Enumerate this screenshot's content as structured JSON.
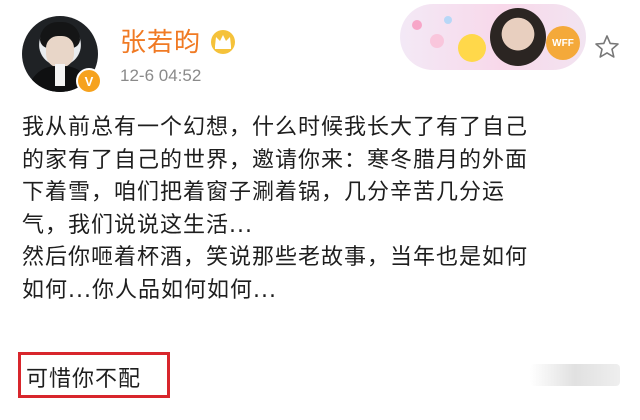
{
  "post": {
    "username": "张若昀",
    "timestamp": "12-6 04:52",
    "verified_badge": "V",
    "icons": {
      "crown": "crown-icon",
      "star": "star-icon",
      "verified": "verified-badge-icon"
    },
    "colors": {
      "username": "#f07a24",
      "timestamp": "#8a8a8a",
      "text": "#1e1e1e",
      "highlight_border": "#d8262c",
      "verified_badge": "#f6a21e"
    },
    "card_skin": {
      "badge_text": "WFF"
    },
    "body_lines": [
      "我从前总有一个幻想，什么时候我长大了有了自己",
      "的家有了自己的世界，邀请你来：寒冬腊月的外面",
      "下着雪，咱们把着窗子涮着锅，几分辛苦几分运",
      "气，我们说说这生活...",
      "然后你咂着杯酒，笑说那些老故事，当年也是如何",
      "如何...你人品如何如何..."
    ],
    "highlighted_line": "可惜你不配"
  }
}
